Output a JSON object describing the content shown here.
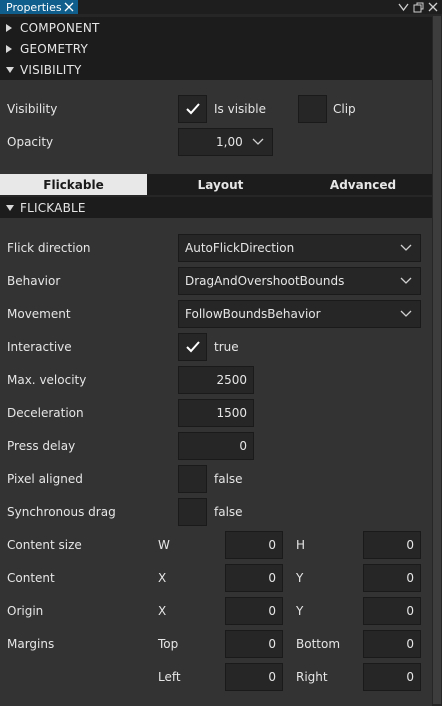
{
  "title_bar": {
    "tab_label": "Properties"
  },
  "sections": {
    "component": "COMPONENT",
    "geometry": "GEOMETRY",
    "visibility": "VISIBILITY",
    "flickable": "FLICKABLE"
  },
  "visibility": {
    "visibility_label": "Visibility",
    "is_visible_label": "Is visible",
    "is_visible_checked": true,
    "clip_label": "Clip",
    "clip_checked": false,
    "opacity_label": "Opacity",
    "opacity_value": "1,00"
  },
  "tabs": [
    {
      "label": "Flickable",
      "active": true
    },
    {
      "label": "Layout",
      "active": false
    },
    {
      "label": "Advanced",
      "active": false
    }
  ],
  "flickable": {
    "flick_direction_label": "Flick direction",
    "flick_direction_value": "AutoFlickDirection",
    "behavior_label": "Behavior",
    "behavior_value": "DragAndOvershootBounds",
    "movement_label": "Movement",
    "movement_value": "FollowBoundsBehavior",
    "interactive_label": "Interactive",
    "interactive_text": "true",
    "interactive_checked": true,
    "max_velocity_label": "Max. velocity",
    "max_velocity_value": "2500",
    "deceleration_label": "Deceleration",
    "deceleration_value": "1500",
    "press_delay_label": "Press delay",
    "press_delay_value": "0",
    "pixel_aligned_label": "Pixel aligned",
    "pixel_aligned_text": "false",
    "synchronous_drag_label": "Synchronous drag",
    "synchronous_drag_text": "false",
    "content_size_label": "Content size",
    "content_size_w_label": "W",
    "content_size_w_value": "0",
    "content_size_h_label": "H",
    "content_size_h_value": "0",
    "content_label": "Content",
    "content_x_label": "X",
    "content_x_value": "0",
    "content_y_label": "Y",
    "content_y_value": "0",
    "origin_label": "Origin",
    "origin_x_label": "X",
    "origin_x_value": "0",
    "origin_y_label": "Y",
    "origin_y_value": "0",
    "margins_label": "Margins",
    "margins_top_label": "Top",
    "margins_top_value": "0",
    "margins_bottom_label": "Bottom",
    "margins_bottom_value": "0",
    "margins_left_label": "Left",
    "margins_left_value": "0",
    "margins_right_label": "Right",
    "margins_right_value": "0"
  },
  "colors": {
    "accent": "#0f5e8c",
    "panel_bg": "#333333",
    "section_bg": "#1c1c1c",
    "field_bg": "#262626"
  }
}
